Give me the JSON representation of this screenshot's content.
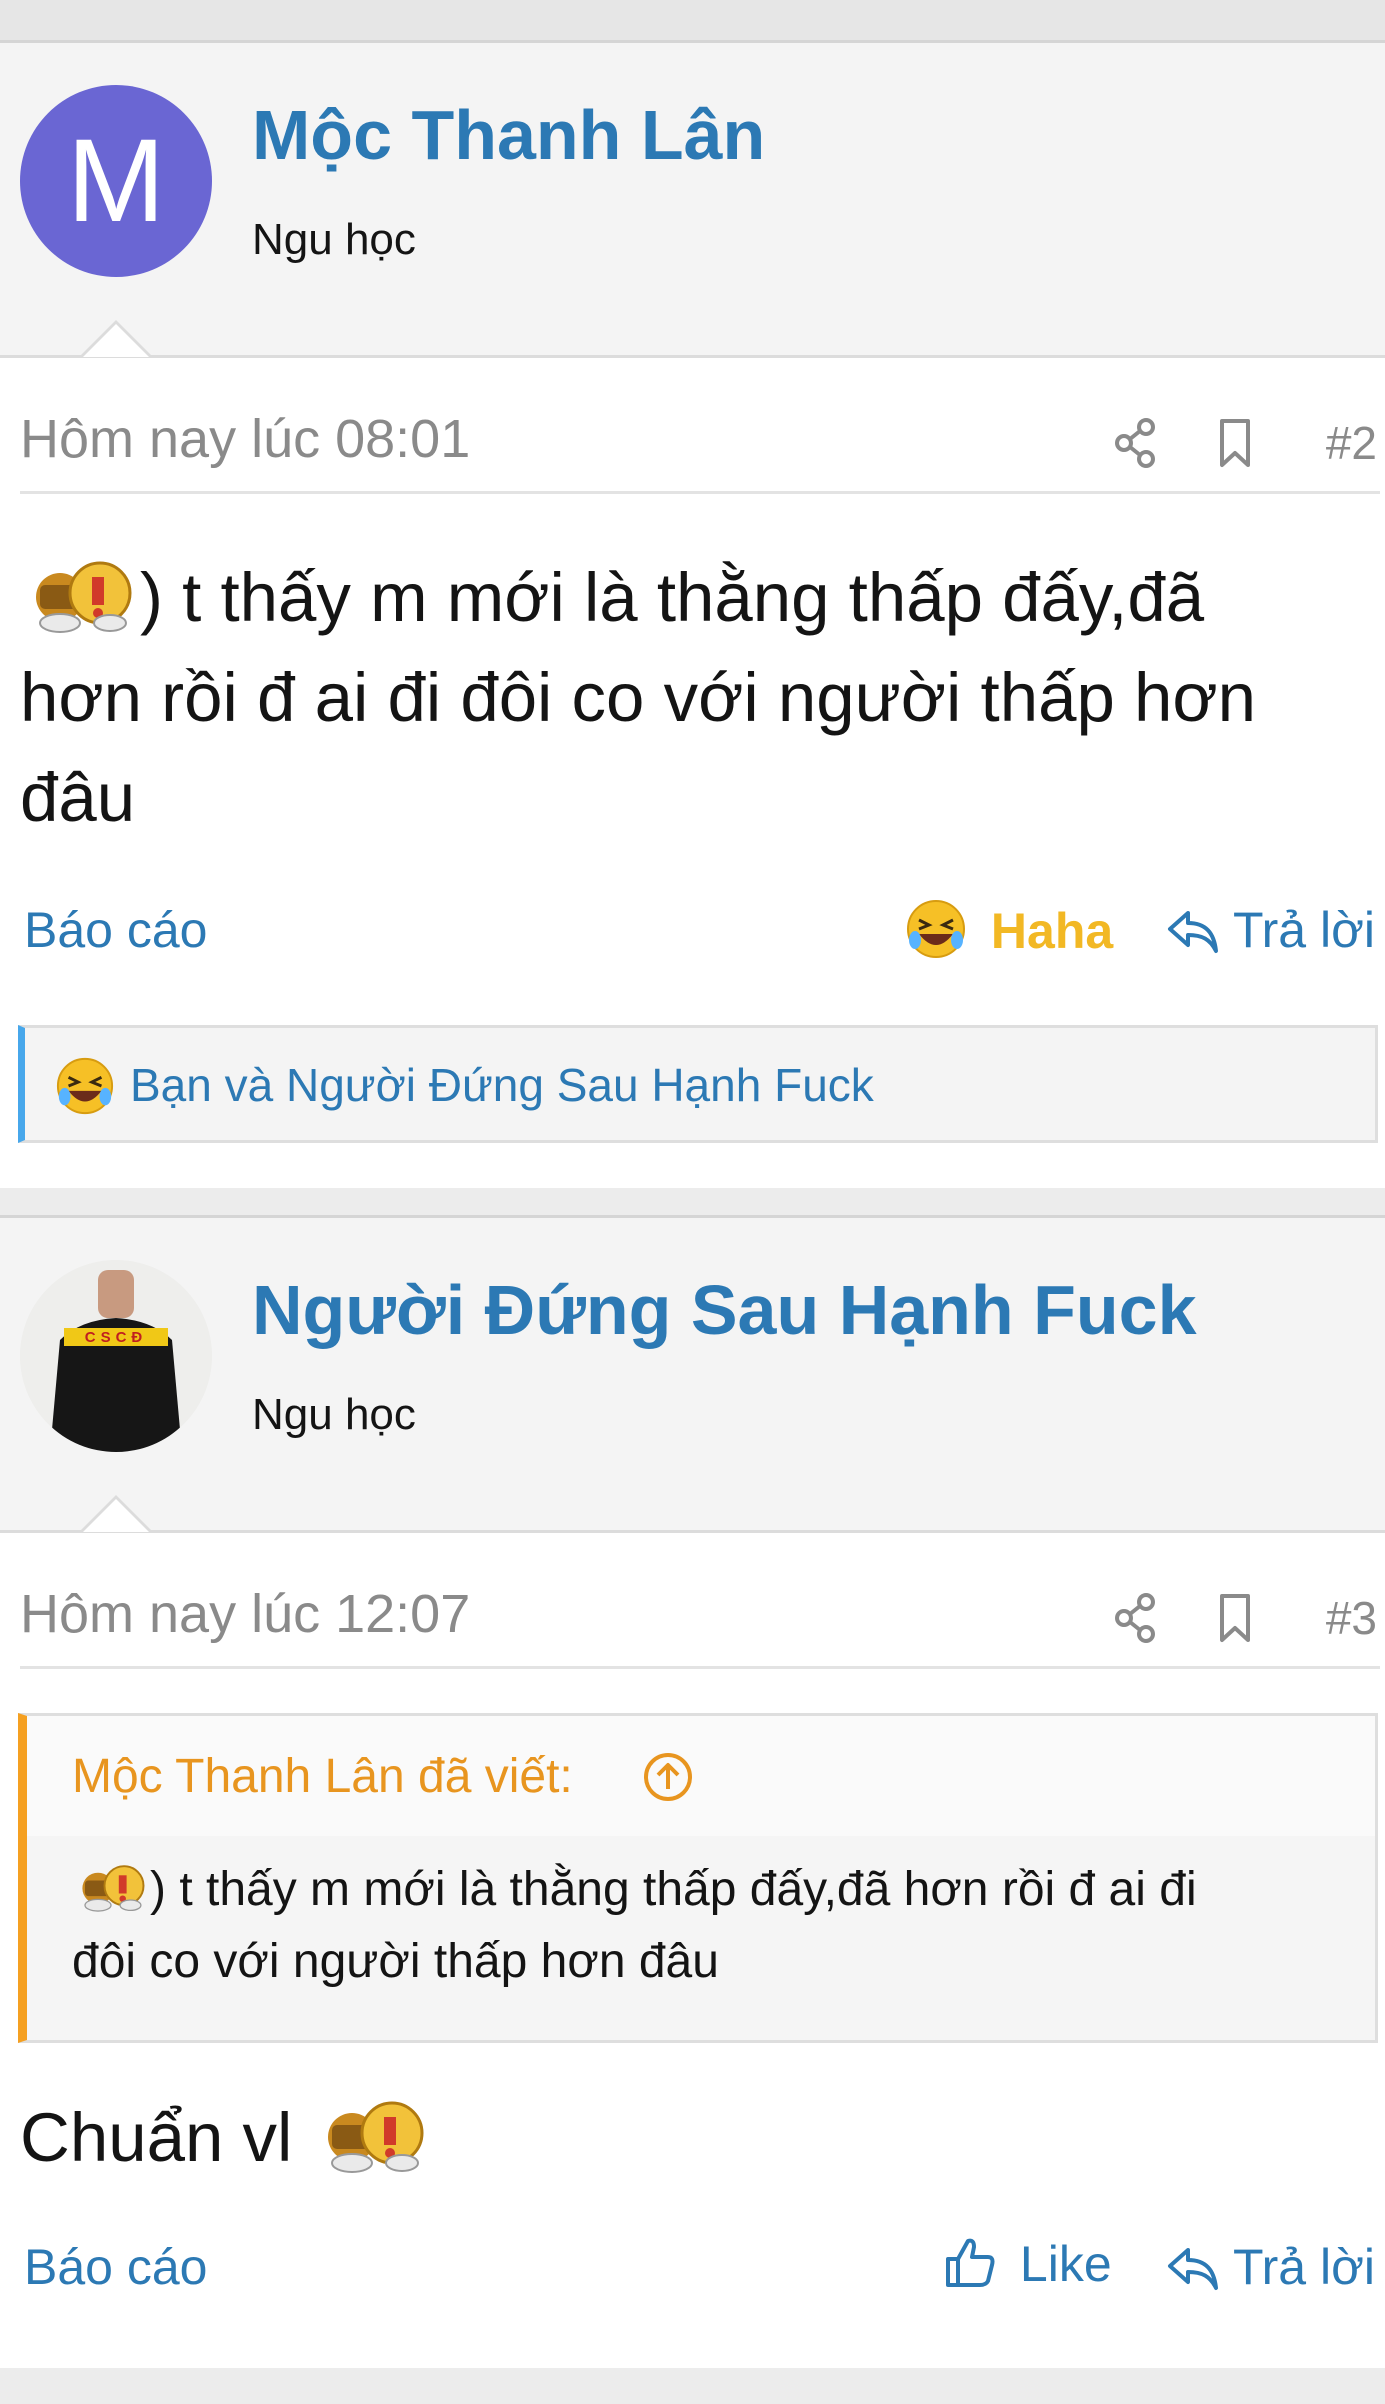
{
  "posts": [
    {
      "author": "Mộc Thanh Lân",
      "avatar_letter": "M",
      "user_title": "Ngu học",
      "time": "Hôm nay lúc 08:01",
      "post_number": "#2",
      "content_line1": ") t thấy m mới là thằng thấp đấy,đã",
      "content_line2": "hơn rồi đ ai đi đôi co với người thấp hơn",
      "content_line3": "đâu",
      "report_label": "Báo cáo",
      "reaction_label": "Haha",
      "reply_label": "Trả lời",
      "reactions_summary": "Bạn và Người Đứng Sau Hạnh Fuck"
    },
    {
      "author": "Người Đứng Sau Hạnh Fuck",
      "avatar_shirt_text": "CSCĐ",
      "user_title": "Ngu học",
      "time": "Hôm nay lúc 12:07",
      "post_number": "#3",
      "quote_title": "Mộc Thanh Lân đã viết:",
      "quote_line1": ") t thấy m mới là thằng thấp đấy,đã hơn rồi đ ai đi",
      "quote_line2": "đôi co với người thấp hơn đâu",
      "content": "Chuẩn vl",
      "report_label": "Báo cáo",
      "like_label": "Like",
      "reply_label": "Trả lời"
    }
  ],
  "colors": {
    "link": "#2c79b4",
    "haha": "#f2b824",
    "quote_accent": "#f5a021",
    "reaction_accent": "#47a7eb",
    "avatar_bg": "#6a66d3"
  },
  "icons": {
    "share": "share-icon",
    "bookmark": "bookmark-icon",
    "reply": "reply-icon",
    "like": "thumbs-up-icon",
    "haha": "laughing-emoji-icon",
    "quote_jump": "arrow-up-circle-icon",
    "sticker": "sticker-emoji-icon"
  }
}
